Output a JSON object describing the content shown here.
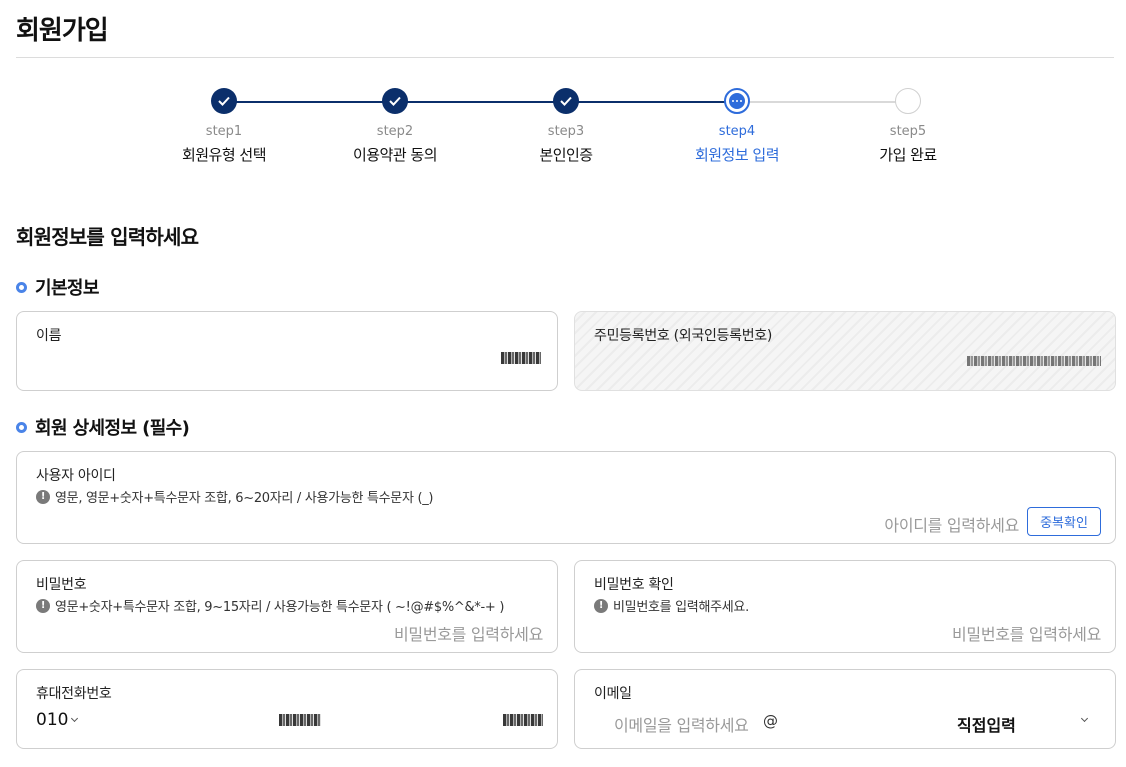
{
  "page": {
    "title": "회원가입"
  },
  "stepper": {
    "steps": [
      {
        "num": "step1",
        "label": "회원유형 선택",
        "state": "done"
      },
      {
        "num": "step2",
        "label": "이용약관 동의",
        "state": "done"
      },
      {
        "num": "step3",
        "label": "본인인증",
        "state": "done"
      },
      {
        "num": "step4",
        "label": "회원정보 입력",
        "state": "current"
      },
      {
        "num": "step5",
        "label": "가입 완료",
        "state": "todo"
      }
    ]
  },
  "form": {
    "heading": "회원정보를 입력하세요",
    "basic": {
      "heading": "기본정보",
      "name_label": "이름",
      "rrn_label": "주민등록번호 (외국인등록번호)"
    },
    "detail": {
      "heading": "회원 상세정보 (필수)",
      "userid": {
        "label": "사용자 아이디",
        "hint": "영문, 영문+숫자+특수문자 조합, 6~20자리 / 사용가능한 특수문자 (_)",
        "placeholder": "아이디를 입력하세요",
        "button": "중복확인"
      },
      "password": {
        "label": "비밀번호",
        "hint": "영문+숫자+특수문자 조합, 9~15자리 / 사용가능한 특수문자 ( ~!@#$%^&*-+ )",
        "placeholder": "비밀번호를 입력하세요"
      },
      "password_confirm": {
        "label": "비밀번호 확인",
        "hint": "비밀번호를 입력해주세요.",
        "placeholder": "비밀번호를 입력하세요"
      },
      "phone": {
        "label": "휴대전화번호",
        "prefix": "010"
      },
      "email": {
        "label": "이메일",
        "placeholder": "이메일을 입력하세요",
        "at": "@",
        "domain_select": "직접입력"
      }
    }
  },
  "colors": {
    "done": "#0b2f6b",
    "active": "#2e6cdb",
    "bullet": "#4a84e8"
  },
  "icons": {
    "step_done": "check-icon",
    "step_current": "ellipsis-icon",
    "hint": "exclamation-circle-icon",
    "dropdown": "chevron-down-icon"
  }
}
